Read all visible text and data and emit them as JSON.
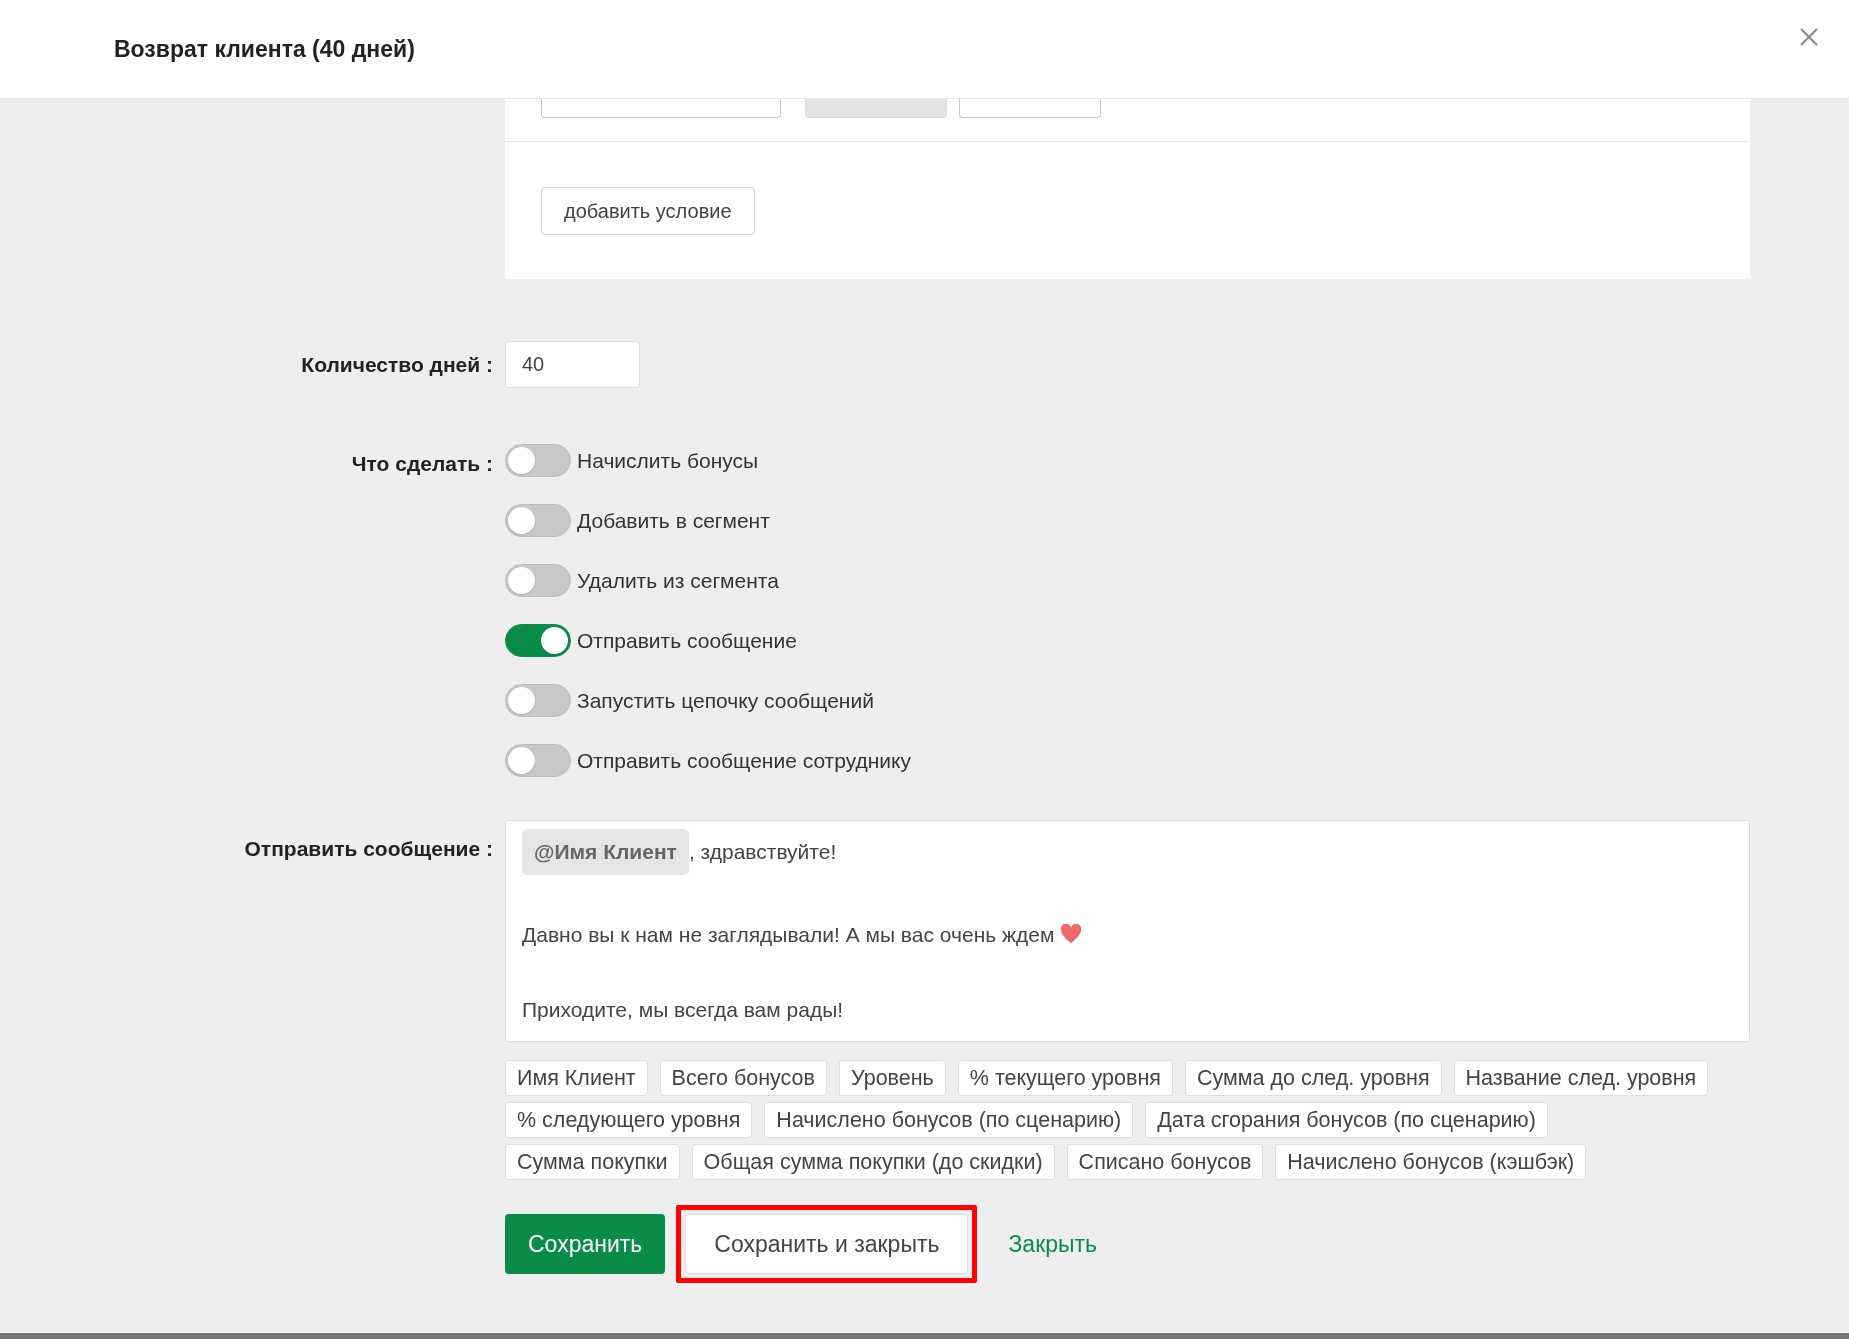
{
  "window": {
    "title": "Возврат клиента (40 дней)"
  },
  "conditions": {
    "partial_buttons": [
      {
        "kind": "select",
        "disabled": false
      },
      {
        "kind": "button",
        "disabled": true
      },
      {
        "kind": "button",
        "disabled": false
      }
    ],
    "add_button": "добавить условие"
  },
  "days": {
    "label": "Количество дней :",
    "value": "40"
  },
  "actions": {
    "label": "Что сделать :",
    "items": [
      {
        "label": "Начислить бонусы",
        "on": false
      },
      {
        "label": "Добавить в сегмент",
        "on": false
      },
      {
        "label": "Удалить из сегмента",
        "on": false
      },
      {
        "label": "Отправить сообщение",
        "on": true
      },
      {
        "label": "Запустить цепочку сообщений",
        "on": false
      },
      {
        "label": "Отправить сообщение сотруднику",
        "on": false
      }
    ]
  },
  "message": {
    "label": "Отправить сообщение :",
    "mention": "@Имя Клиент",
    "greeting": ", здравствуйте!",
    "lines": [
      {
        "text": "Давно вы к нам не заглядывали! А мы вас очень ждем",
        "heart": true
      },
      {
        "text": "Приходите, мы всегда вам рады!",
        "heart": false
      }
    ],
    "variables": [
      "Имя Клиент",
      "Всего бонусов",
      "Уровень",
      "% текущего уровня",
      "Сумма до след. уровня",
      "Название след. уровня",
      "% следующего уровня",
      "Начислено бонусов (по сценарию)",
      "Дата сгорания бонусов (по сценарию)",
      "Сумма покупки",
      "Общая сумма покупки (до скидки)",
      "Списано бонусов",
      "Начислено бонусов (кэшбэк)"
    ]
  },
  "footer": [
    {
      "label": "Сохранить",
      "kind": "primary",
      "highlighted": false
    },
    {
      "label": "Сохранить и закрыть",
      "kind": "secondary",
      "highlighted": true
    },
    {
      "label": "Закрыть",
      "kind": "link",
      "highlighted": false
    }
  ]
}
